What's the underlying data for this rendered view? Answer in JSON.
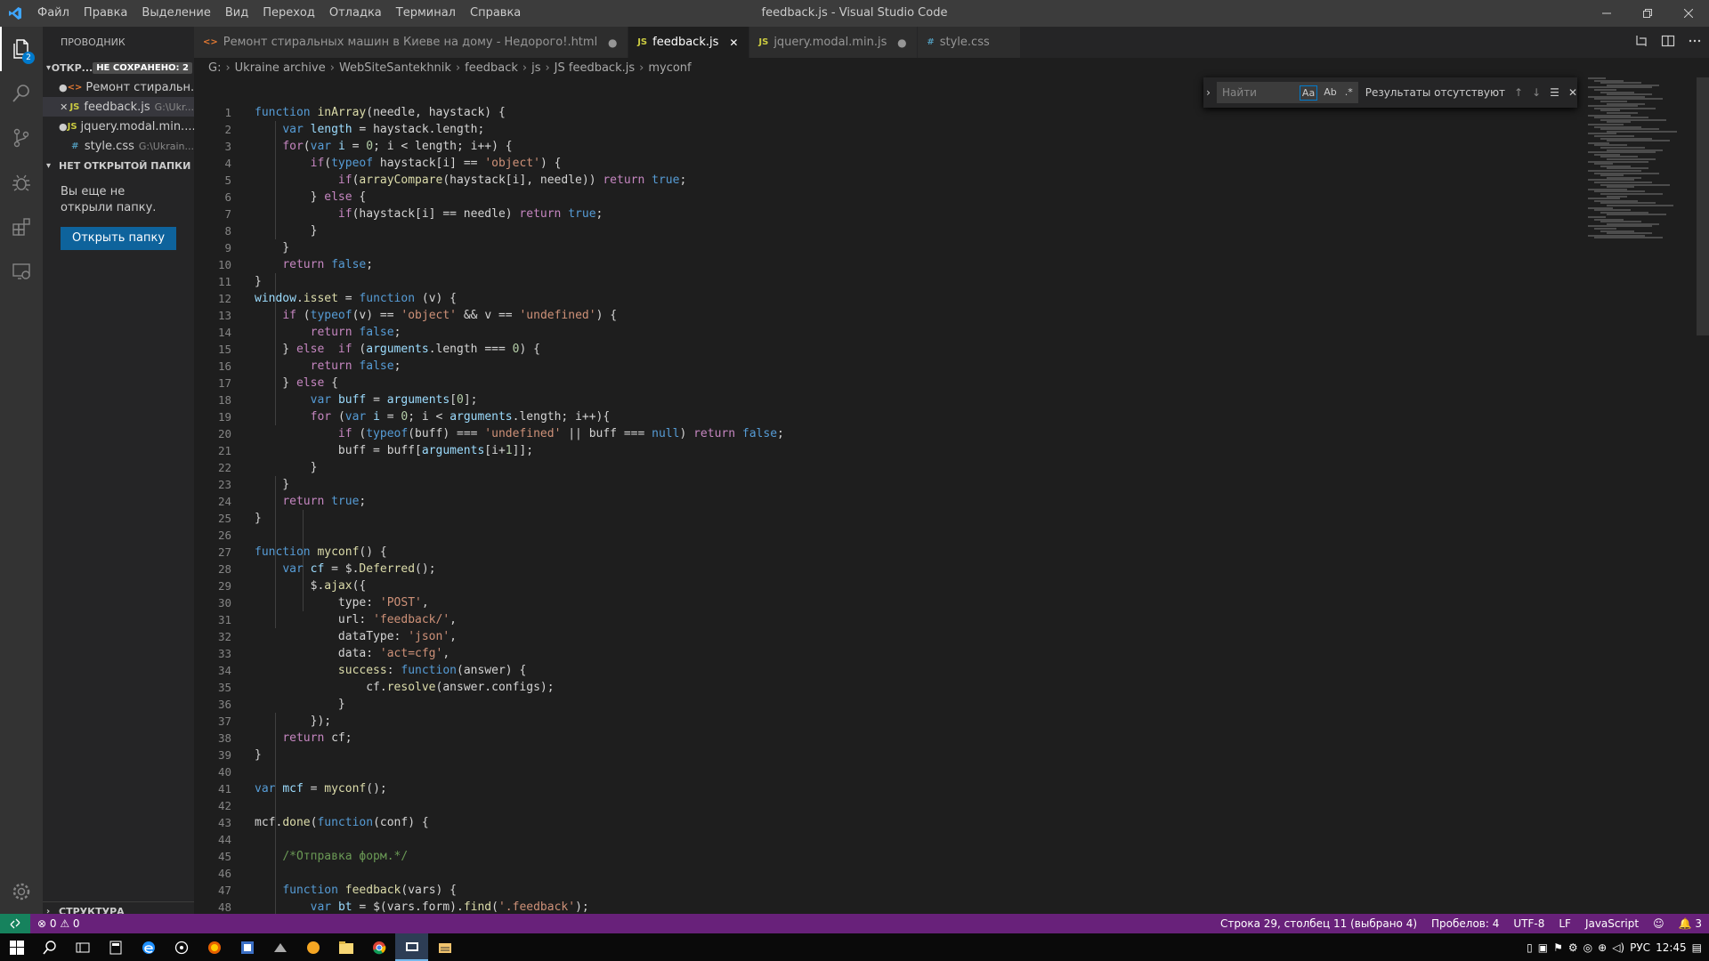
{
  "titlebar": {
    "menu": [
      "Файл",
      "Правка",
      "Выделение",
      "Вид",
      "Переход",
      "Отладка",
      "Терминал",
      "Справка"
    ],
    "title": "feedback.js - Visual Studio Code"
  },
  "activity": {
    "explorer_badge": "2"
  },
  "sidebar": {
    "title": "ПРОВОДНИК",
    "open_editors": "ОТКР...",
    "unsaved": "НЕ СОХРАНЕНО: 2",
    "files": [
      {
        "mark": "●",
        "icon": "<>",
        "icon_color": "#e37933",
        "name": "Ремонт стиральн...",
        "path": ""
      },
      {
        "mark": "✕",
        "icon": "JS",
        "icon_color": "#cbcb41",
        "name": "feedback.js",
        "path": "G:\\Ukr..."
      },
      {
        "mark": "●",
        "icon": "JS",
        "icon_color": "#cbcb41",
        "name": "jquery.modal.min....",
        "path": ""
      },
      {
        "mark": "",
        "icon": "#",
        "icon_color": "#519aba",
        "name": "style.css",
        "path": "G:\\Ukrain..."
      }
    ],
    "no_folder": "НЕТ ОТКРЫТОЙ ПАПКИ",
    "empty_text": "Вы еще не открыли папку.",
    "open_button": "Открыть папку",
    "structure": "СТРУКТУРА"
  },
  "tabs": [
    {
      "icon": "<>",
      "icon_color": "#e37933",
      "label": "Ремонт стиральных машин в Киеве на дому - Недорого!.html",
      "close": "●",
      "active": false
    },
    {
      "icon": "JS",
      "icon_color": "#cbcb41",
      "label": "feedback.js",
      "close": "✕",
      "active": true
    },
    {
      "icon": "JS",
      "icon_color": "#cbcb41",
      "label": "jquery.modal.min.js",
      "close": "●",
      "active": false
    },
    {
      "icon": "#",
      "icon_color": "#519aba",
      "label": "style.css",
      "close": "",
      "active": false
    }
  ],
  "breadcrumb": [
    "G:",
    "Ukraine archive",
    "WebSiteSantekhnik",
    "feedback",
    "js",
    "JS feedback.js",
    "myconf"
  ],
  "find": {
    "placeholder": "Найти",
    "opt_case": "Aa",
    "opt_word": "Ab",
    "opt_regex": ".*",
    "result": "Результаты отсутствуют"
  },
  "code": {
    "start_line": 1,
    "lines": [
      [
        [
          "k",
          "function "
        ],
        [
          "f",
          "inArray"
        ],
        [
          "",
          "(needle, haystack) {"
        ]
      ],
      [
        [
          "",
          "    "
        ],
        [
          "k",
          "var "
        ],
        [
          "v",
          "length"
        ],
        [
          "",
          " = haystack.length;"
        ]
      ],
      [
        [
          "",
          "    "
        ],
        [
          "ctl",
          "for"
        ],
        [
          "",
          "("
        ],
        [
          "k",
          "var "
        ],
        [
          "v",
          "i"
        ],
        [
          "",
          " = "
        ],
        [
          "n",
          "0"
        ],
        [
          "",
          "; i < length; i++) {"
        ]
      ],
      [
        [
          "",
          "        "
        ],
        [
          "ctl",
          "if"
        ],
        [
          "",
          "("
        ],
        [
          "k",
          "typeof "
        ],
        [
          "",
          "haystack[i] == "
        ],
        [
          "s",
          "'object'"
        ],
        [
          "",
          ") {"
        ]
      ],
      [
        [
          "",
          "            "
        ],
        [
          "ctl",
          "if"
        ],
        [
          "",
          "("
        ],
        [
          "f",
          "arrayCompare"
        ],
        [
          "",
          "(haystack[i], needle)) "
        ],
        [
          "ctl",
          "return "
        ],
        [
          "k",
          "true"
        ],
        [
          "",
          ";"
        ]
      ],
      [
        [
          "",
          "        } "
        ],
        [
          "ctl",
          "else"
        ],
        [
          "",
          " {"
        ]
      ],
      [
        [
          "",
          "            "
        ],
        [
          "ctl",
          "if"
        ],
        [
          "",
          "(haystack[i] == needle) "
        ],
        [
          "ctl",
          "return "
        ],
        [
          "k",
          "true"
        ],
        [
          "",
          ";"
        ]
      ],
      [
        [
          "",
          "        }"
        ]
      ],
      [
        [
          "",
          "    }"
        ]
      ],
      [
        [
          "",
          "    "
        ],
        [
          "ctl",
          "return "
        ],
        [
          "k",
          "false"
        ],
        [
          "",
          ";"
        ]
      ],
      [
        [
          "",
          "}"
        ]
      ],
      [
        [
          "v",
          "window"
        ],
        [
          "",
          "."
        ],
        [
          "f",
          "isset"
        ],
        [
          "",
          " = "
        ],
        [
          "k",
          "function "
        ],
        [
          "",
          "(v) {"
        ]
      ],
      [
        [
          "",
          "    "
        ],
        [
          "ctl",
          "if "
        ],
        [
          "",
          "("
        ],
        [
          "k",
          "typeof"
        ],
        [
          "",
          "(v) == "
        ],
        [
          "s",
          "'object'"
        ],
        [
          "",
          " && v == "
        ],
        [
          "s",
          "'undefined'"
        ],
        [
          "",
          ") {"
        ]
      ],
      [
        [
          "",
          "        "
        ],
        [
          "ctl",
          "return "
        ],
        [
          "k",
          "false"
        ],
        [
          "",
          ";"
        ]
      ],
      [
        [
          "",
          "    } "
        ],
        [
          "ctl",
          "else  if "
        ],
        [
          "",
          "("
        ],
        [
          "v",
          "arguments"
        ],
        [
          "",
          ".length === "
        ],
        [
          "n",
          "0"
        ],
        [
          "",
          ") {"
        ]
      ],
      [
        [
          "",
          "        "
        ],
        [
          "ctl",
          "return "
        ],
        [
          "k",
          "false"
        ],
        [
          "",
          ";"
        ]
      ],
      [
        [
          "",
          "    } "
        ],
        [
          "ctl",
          "else"
        ],
        [
          "",
          " {"
        ]
      ],
      [
        [
          "",
          "        "
        ],
        [
          "k",
          "var "
        ],
        [
          "v",
          "buff"
        ],
        [
          "",
          " = "
        ],
        [
          "v",
          "arguments"
        ],
        [
          "",
          "["
        ],
        [
          "n",
          "0"
        ],
        [
          "",
          "];"
        ]
      ],
      [
        [
          "",
          "        "
        ],
        [
          "ctl",
          "for "
        ],
        [
          "",
          "("
        ],
        [
          "k",
          "var "
        ],
        [
          "v",
          "i"
        ],
        [
          "",
          " = "
        ],
        [
          "n",
          "0"
        ],
        [
          "",
          "; i < "
        ],
        [
          "v",
          "arguments"
        ],
        [
          "",
          ".length; i++){"
        ]
      ],
      [
        [
          "",
          "            "
        ],
        [
          "ctl",
          "if "
        ],
        [
          "",
          "("
        ],
        [
          "k",
          "typeof"
        ],
        [
          "",
          "(buff) === "
        ],
        [
          "s",
          "'undefined'"
        ],
        [
          "",
          " || buff === "
        ],
        [
          "k",
          "null"
        ],
        [
          "",
          ") "
        ],
        [
          "ctl",
          "return "
        ],
        [
          "k",
          "false"
        ],
        [
          "",
          ";"
        ]
      ],
      [
        [
          "",
          "            buff = buff["
        ],
        [
          "v",
          "arguments"
        ],
        [
          "",
          "[i+"
        ],
        [
          "n",
          "1"
        ],
        [
          "",
          "]];"
        ]
      ],
      [
        [
          "",
          "        }"
        ]
      ],
      [
        [
          "",
          "    }"
        ]
      ],
      [
        [
          "",
          "    "
        ],
        [
          "ctl",
          "return "
        ],
        [
          "k",
          "true"
        ],
        [
          "",
          ";"
        ]
      ],
      [
        [
          "",
          "}"
        ]
      ],
      [
        [
          "",
          ""
        ]
      ],
      [
        [
          "k",
          "function "
        ],
        [
          "f",
          "myconf"
        ],
        [
          "",
          "() {"
        ]
      ],
      [
        [
          "",
          "    "
        ],
        [
          "k",
          "var "
        ],
        [
          "v",
          "cf"
        ],
        [
          "",
          " = $."
        ],
        [
          "f",
          "Deferred"
        ],
        [
          "",
          "();"
        ]
      ],
      [
        [
          "",
          "        $."
        ],
        [
          "f",
          "ajax"
        ],
        [
          "",
          "({"
        ]
      ],
      [
        [
          "",
          "            type: "
        ],
        [
          "s",
          "'POST'"
        ],
        [
          "",
          ","
        ]
      ],
      [
        [
          "",
          "            url: "
        ],
        [
          "s",
          "'feedback/'"
        ],
        [
          "",
          ","
        ]
      ],
      [
        [
          "",
          "            dataType: "
        ],
        [
          "s",
          "'json'"
        ],
        [
          "",
          ","
        ]
      ],
      [
        [
          "",
          "            data: "
        ],
        [
          "s",
          "'act=cfg'"
        ],
        [
          "",
          ","
        ]
      ],
      [
        [
          "",
          "            "
        ],
        [
          "f",
          "success"
        ],
        [
          "",
          ": "
        ],
        [
          "k",
          "function"
        ],
        [
          "",
          "(answer) {"
        ]
      ],
      [
        [
          "",
          "                cf."
        ],
        [
          "f",
          "resolve"
        ],
        [
          "",
          "(answer.configs);"
        ]
      ],
      [
        [
          "",
          "            }"
        ]
      ],
      [
        [
          "",
          "        });"
        ]
      ],
      [
        [
          "",
          "    "
        ],
        [
          "ctl",
          "return "
        ],
        [
          "",
          "cf;"
        ]
      ],
      [
        [
          "",
          "}"
        ]
      ],
      [
        [
          "",
          ""
        ]
      ],
      [
        [
          "k",
          "var "
        ],
        [
          "v",
          "mcf"
        ],
        [
          "",
          " = "
        ],
        [
          "f",
          "myconf"
        ],
        [
          "",
          "();"
        ]
      ],
      [
        [
          "",
          ""
        ]
      ],
      [
        [
          "",
          "mcf."
        ],
        [
          "f",
          "done"
        ],
        [
          "",
          "("
        ],
        [
          "k",
          "function"
        ],
        [
          "",
          "(conf) {"
        ]
      ],
      [
        [
          "",
          ""
        ]
      ],
      [
        [
          "",
          "    "
        ],
        [
          "c",
          "/*Отправка форм.*/"
        ]
      ],
      [
        [
          "",
          ""
        ]
      ],
      [
        [
          "",
          "    "
        ],
        [
          "k",
          "function "
        ],
        [
          "f",
          "feedback"
        ],
        [
          "",
          "(vars) {"
        ]
      ],
      [
        [
          "",
          "        "
        ],
        [
          "k",
          "var "
        ],
        [
          "v",
          "bt"
        ],
        [
          "",
          " = $(vars.form)."
        ],
        [
          "f",
          "find"
        ],
        [
          "",
          "("
        ],
        [
          "s",
          "'.feedback'"
        ],
        [
          "",
          ");"
        ]
      ]
    ]
  },
  "statusbar": {
    "errors": "⊗ 0 ⚠ 0",
    "position": "Строка 29, столбец 11 (выбрано 4)",
    "spaces": "Пробелов: 4",
    "encoding": "UTF-8",
    "eol": "LF",
    "language": "JavaScript",
    "notifications": "🔔 3"
  },
  "taskbar": {
    "lang": "РУС",
    "time": "12:45"
  }
}
